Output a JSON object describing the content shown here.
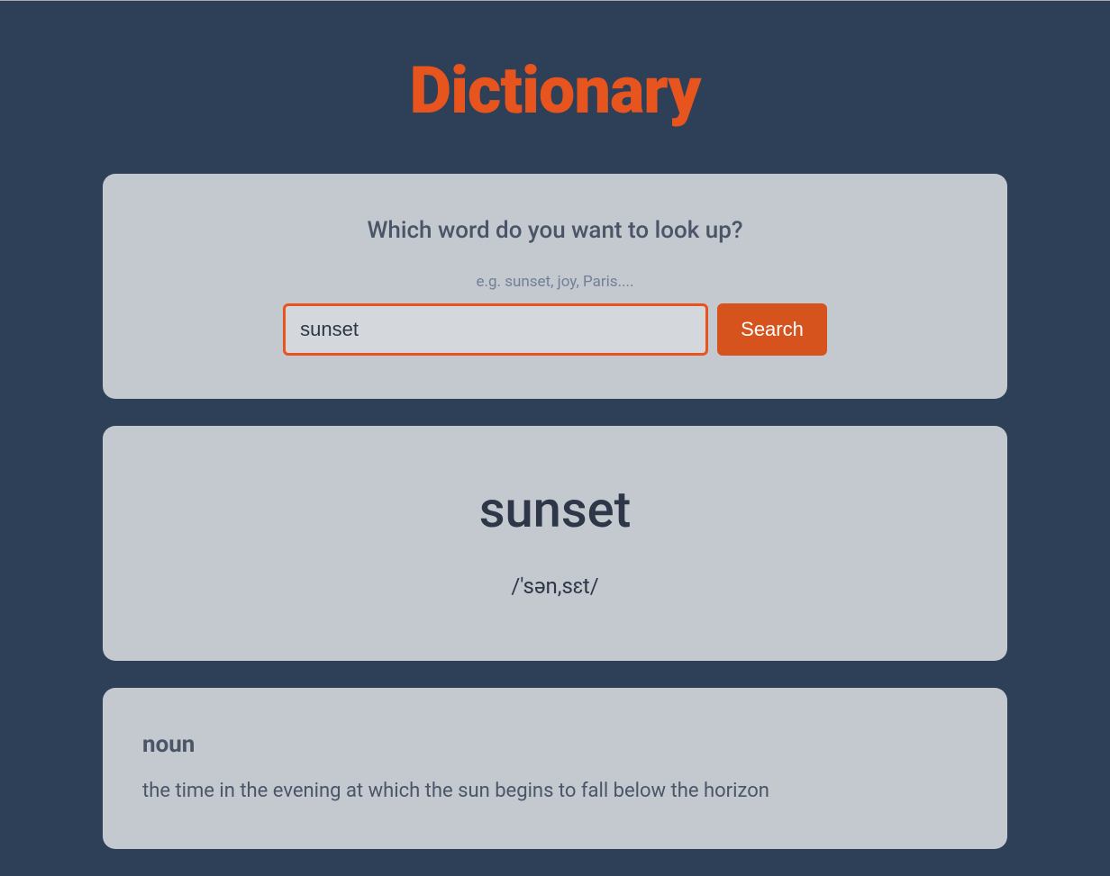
{
  "header": {
    "title": "Dictionary"
  },
  "search": {
    "prompt": "Which word do you want to look up?",
    "hint": "e.g. sunset, joy, Paris....",
    "value": "sunset",
    "button_label": "Search"
  },
  "result": {
    "word": "sunset",
    "phonetic": "/'sən,sɛt/"
  },
  "definition": {
    "part_of_speech": "noun",
    "text": "the time in the evening at which the sun begins to fall below the horizon"
  }
}
